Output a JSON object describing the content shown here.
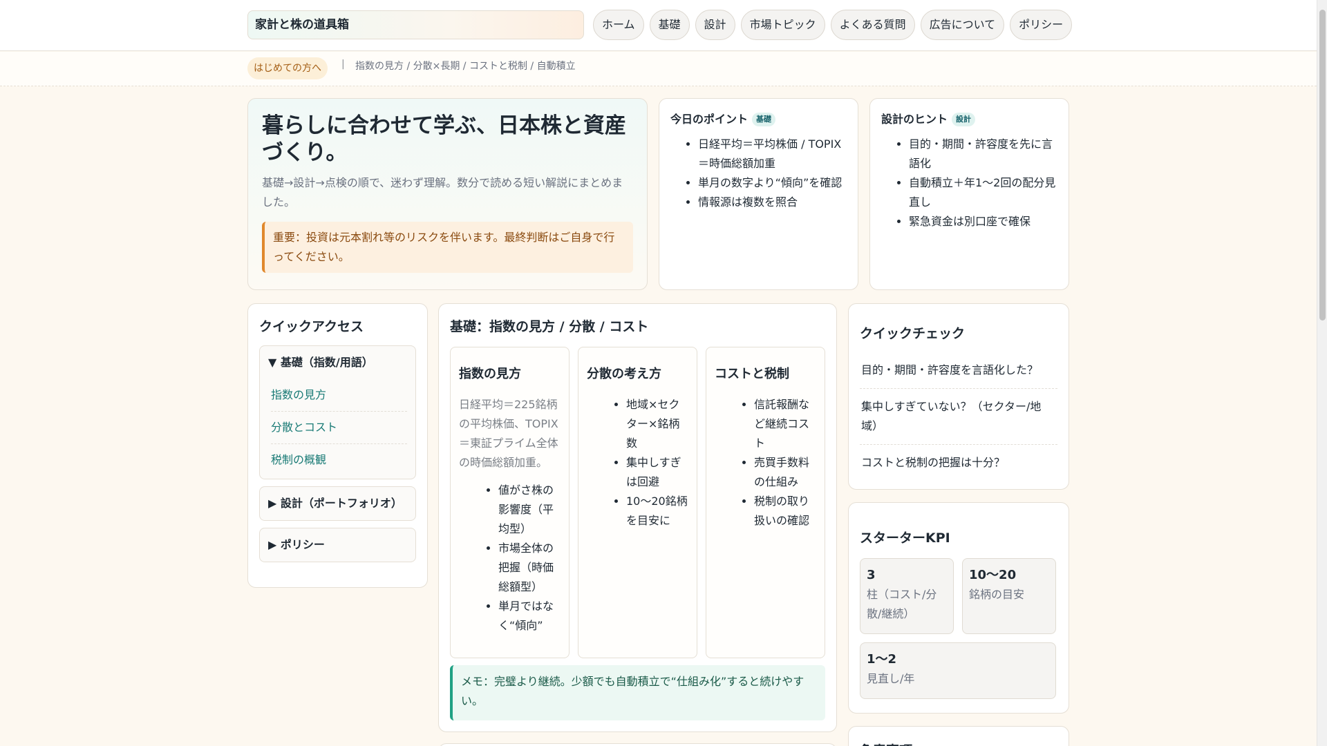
{
  "header": {
    "brand": "家計と株の道具箱",
    "nav": [
      "ホーム",
      "基礎",
      "設計",
      "市場トピック",
      "よくある質問",
      "広告について",
      "ポリシー"
    ]
  },
  "subbar": {
    "tag": "はじめての方へ",
    "separator": "|",
    "crumbs": "指数の見方 / 分散×長期 / コストと税制 / 自動積立"
  },
  "hero": {
    "title": "暮らしに合わせて学ぶ、日本株と資産づくり。",
    "lead": "基礎→設計→点検の順で、迷わず理解。数分で読める短い解説にまとめました。",
    "notice": "重要：投資は元本割れ等のリスクを伴います。最終判断はご自身で行ってください。"
  },
  "tips": [
    {
      "title": "今日のポイント",
      "badge": "基礎",
      "items": [
        "日経平均＝平均株価 / TOPIX＝時価総額加重",
        "単月の数字より“傾向”を確認",
        "情報源は複数を照合"
      ]
    },
    {
      "title": "設計のヒント",
      "badge": "設計",
      "items": [
        "目的・期間・許容度を先に言語化",
        "自動積立＋年1〜2回の配分見直し",
        "緊急資金は別口座で確保"
      ]
    }
  ],
  "quick_access": {
    "title": "クイックアクセス",
    "sections": [
      {
        "label": "▼ 基礎（指数/用語）",
        "links": [
          "指数の見方",
          "分散とコスト",
          "税制の概観"
        ]
      },
      {
        "label": "▶ 設計（ポートフォリオ）"
      },
      {
        "label": "▶ ポリシー"
      }
    ]
  },
  "basics": {
    "title": "基礎：指数の見方 / 分散 / コスト",
    "columns": [
      {
        "title": "指数の見方",
        "text": "日経平均＝225銘柄の平均株価、TOPIX＝東証プライム全体の時価総額加重。",
        "items": [
          "値がさ株の影響度（平均型）",
          "市場全体の把握（時価総額型）",
          "単月ではなく“傾向”"
        ]
      },
      {
        "title": "分散の考え方",
        "items": [
          "地域×セクター×銘柄数",
          "集中しすぎは回避",
          "10〜20銘柄を目安に"
        ]
      },
      {
        "title": "コストと税制",
        "items": [
          "信託報酬など継続コスト",
          "売買手数料の仕組み",
          "税制の取り扱いの確認"
        ]
      }
    ],
    "memo": "メモ：完璧より継続。少額でも自動積立で“仕組み化”すると続けやすい。"
  },
  "quick_check": {
    "title": "クイックチェック",
    "items": [
      "目的・期間・許容度を言語化した？",
      "集中しすぎていない？（セクター/地域）",
      "コストと税制の把握は十分？"
    ]
  },
  "kpi": {
    "title": "スターターKPI",
    "boxes": [
      {
        "value": "3",
        "label": "柱（コスト/分散/継続）"
      },
      {
        "value": "10〜20",
        "label": "銘柄の目安"
      },
      {
        "value": "1〜2",
        "label": "見直し/年"
      }
    ]
  },
  "notes": {
    "title": "免責事項"
  },
  "colors": {
    "accent": "#187a75",
    "warning": "#e0882c",
    "memo": "#20a184"
  }
}
